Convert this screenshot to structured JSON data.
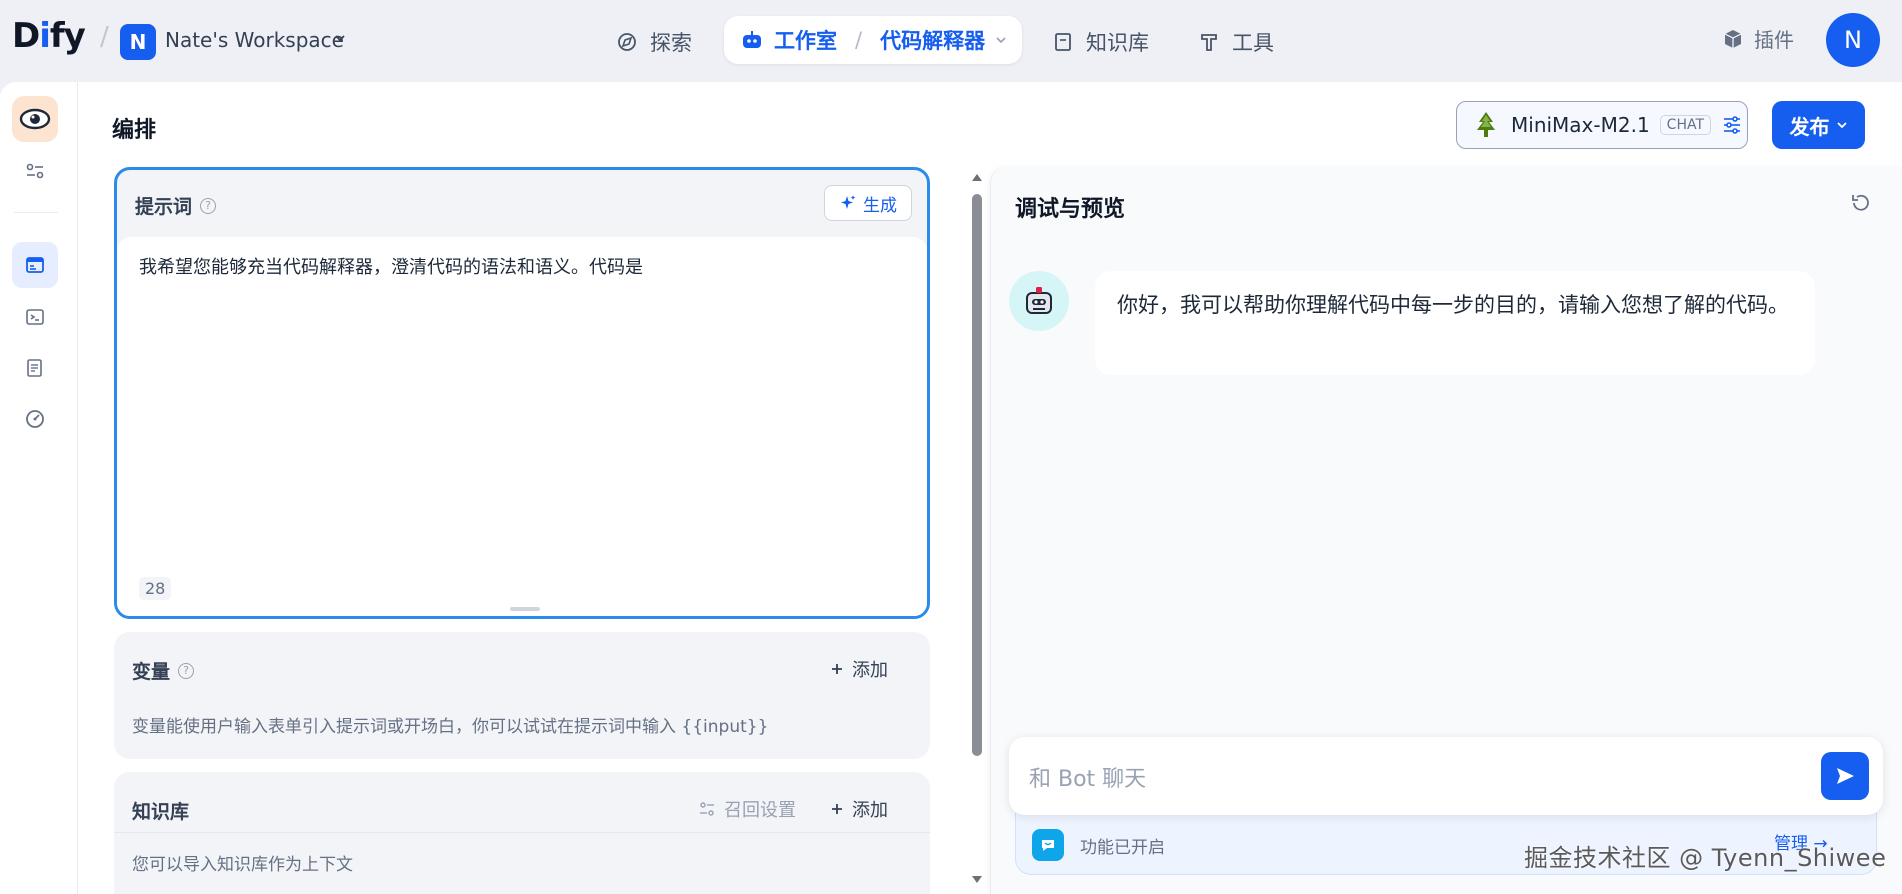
{
  "brand": {
    "logo": "Dify"
  },
  "workspace": {
    "initial": "N",
    "name": "Nate's Workspace"
  },
  "nav": {
    "explore": "探索",
    "studio": "工作室",
    "app_name": "代码解释器",
    "knowledge": "知识库",
    "tools": "工具",
    "plugins": "插件"
  },
  "user": {
    "initial": "N"
  },
  "page": {
    "title": "编排"
  },
  "model": {
    "name": "MiniMax-M2.1",
    "mode": "CHAT"
  },
  "publish": {
    "label": "发布"
  },
  "prompt": {
    "title": "提示词",
    "generate_label": "生成",
    "text": "我希望您能够充当代码解释器，澄清代码的语法和语义。代码是",
    "char_count": "28"
  },
  "variables": {
    "title": "变量",
    "add_label": "添加",
    "description": "变量能使用户输入表单引入提示词或开场白，你可以试试在提示词中输入 {{input}}"
  },
  "knowledge": {
    "title": "知识库",
    "recall_label": "召回设置",
    "add_label": "添加",
    "description": "您可以导入知识库作为上下文"
  },
  "debug": {
    "title": "调试与预览",
    "bot_message": "你好，我可以帮助你理解代码中每一步的目的，请输入您想了解的代码。",
    "input_placeholder": "和 Bot 聊天",
    "feature_status": "功能已开启",
    "manage_label": "管理"
  },
  "watermark": "掘金技术社区 @ Tyenn_Shiwee",
  "colors": {
    "primary": "#155eef",
    "prompt_border": "#2a8bea",
    "app_icon_bg": "#fde4d0"
  },
  "icons": {
    "explore": "compass-icon",
    "studio": "robot-icon",
    "knowledge": "book-icon",
    "tools": "hammer-icon",
    "plugins": "cube-icon"
  }
}
